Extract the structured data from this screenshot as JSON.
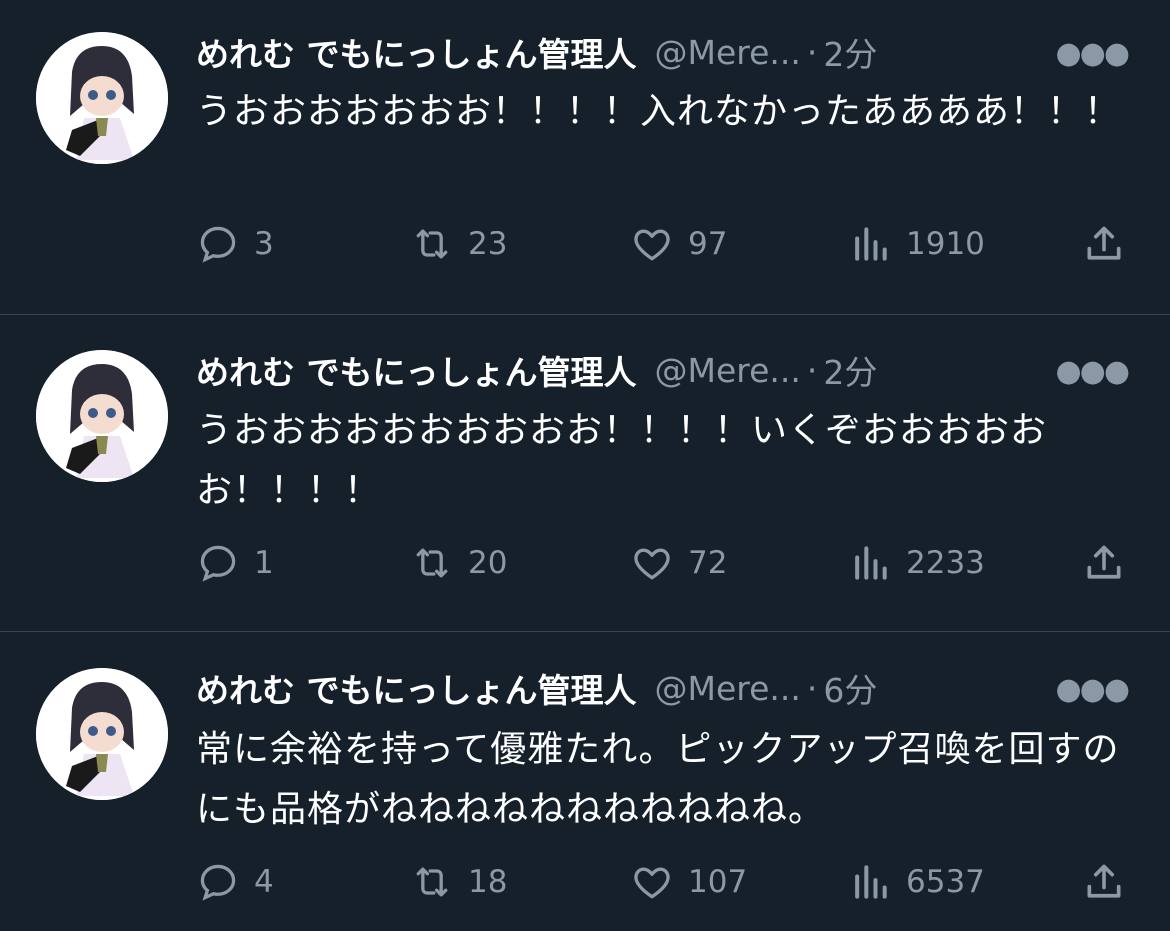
{
  "tweets": [
    {
      "display_name": "めれむ でもにっしょん管理人",
      "handle": "@Mere...",
      "time": "2分",
      "text": "うおおおおおおお！！！！入れなかったああああ！！！",
      "replies": "3",
      "retweets": "23",
      "likes": "97",
      "views": "1910"
    },
    {
      "display_name": "めれむ でもにっしょん管理人",
      "handle": "@Mere...",
      "time": "2分",
      "text": "うおおおおおおおおおお！！！！いくぞおおおおおお！！！！",
      "replies": "1",
      "retweets": "20",
      "likes": "72",
      "views": "2233"
    },
    {
      "display_name": "めれむ でもにっしょん管理人",
      "handle": "@Mere...",
      "time": "6分",
      "text": "常に余裕を持って優雅たれ。ピックアップ召喚を回すのにも品格がねねねねねねねねねねね。",
      "replies": "4",
      "retweets": "18",
      "likes": "107",
      "views": "6537"
    }
  ],
  "separator": "·",
  "colors": {
    "background": "#15202b",
    "secondary_text": "#8b98a5",
    "divider": "#38444d"
  },
  "icons": [
    "reply-icon",
    "retweet-icon",
    "like-icon",
    "views-icon",
    "share-icon",
    "more-icon"
  ]
}
